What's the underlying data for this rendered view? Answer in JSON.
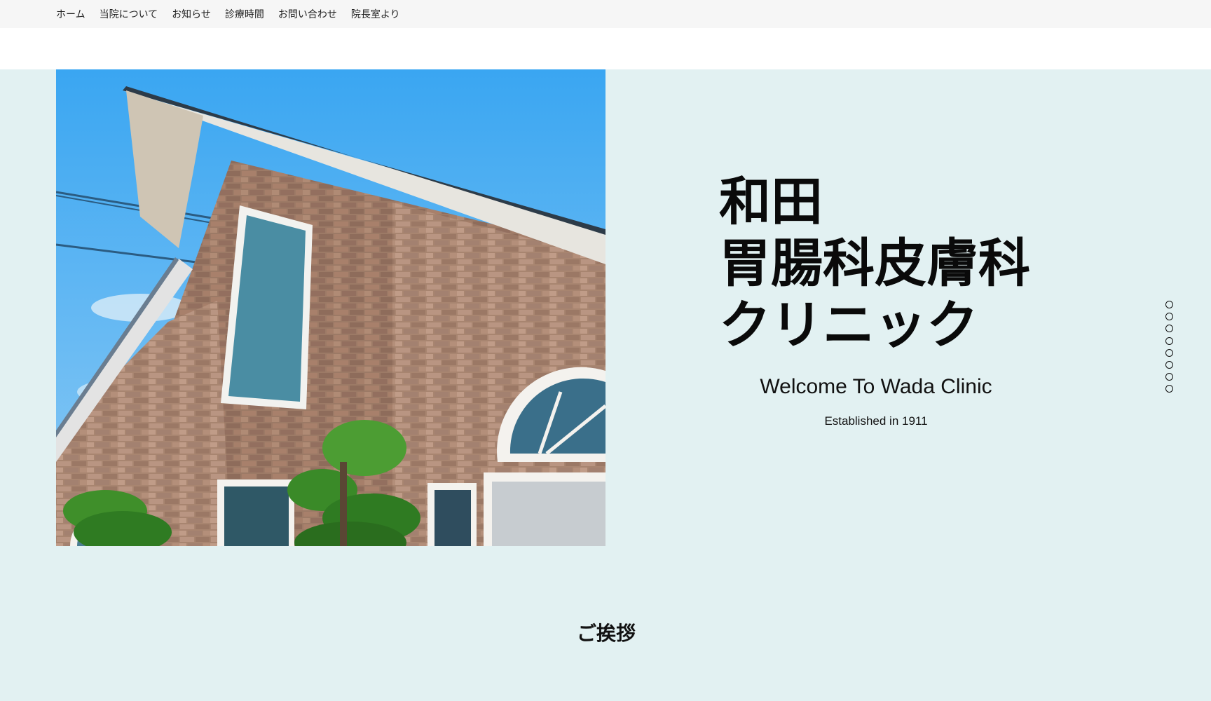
{
  "nav": {
    "items": [
      {
        "label": "ホーム"
      },
      {
        "label": "当院について"
      },
      {
        "label": "お知らせ"
      },
      {
        "label": "診療時間"
      },
      {
        "label": "お問い合わせ"
      },
      {
        "label": "院長室より"
      }
    ]
  },
  "hero": {
    "title_lines": [
      "和田",
      "胃腸科皮膚科",
      "クリニック"
    ],
    "welcome": "Welcome To Wada Clinic",
    "established": "Established in 1911",
    "section_dot_count": 8,
    "background_color": "#e2f1f2"
  },
  "next_section": {
    "heading": "ご挨拶"
  }
}
